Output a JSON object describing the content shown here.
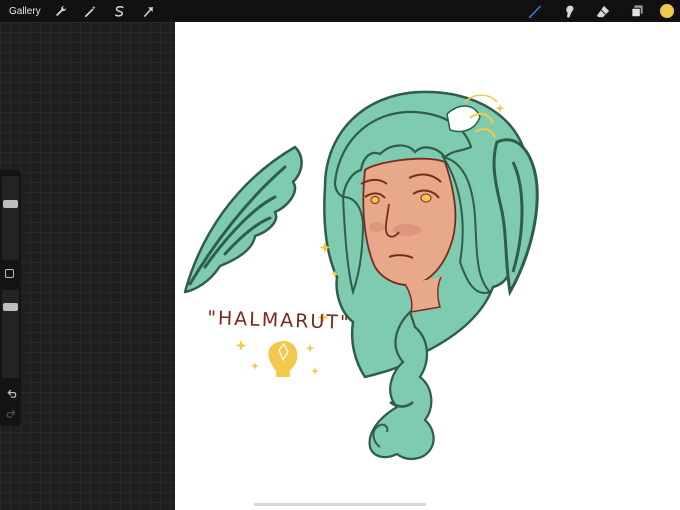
{
  "toolbar": {
    "gallery_label": "Gallery",
    "left_tools": [
      "wrench-icon",
      "magic-wand-icon",
      "selection-icon",
      "transform-arrow-icon"
    ],
    "right_tools": [
      "brush-icon",
      "smudge-icon",
      "eraser-icon",
      "layers-icon"
    ],
    "current_color": "#f2c94c",
    "brush_color": "#3b82f6"
  },
  "sidebar": {
    "brush_size_level": 0.3,
    "opacity_level": 0.15
  },
  "artwork": {
    "lettering": "\"HALMARUT\"",
    "colors": {
      "hair": "#7ecbb0",
      "hair_dark": "#2f5c4b",
      "skin": "#e8a88a",
      "line": "#7a2a1f",
      "gold": "#f2c94c"
    }
  }
}
